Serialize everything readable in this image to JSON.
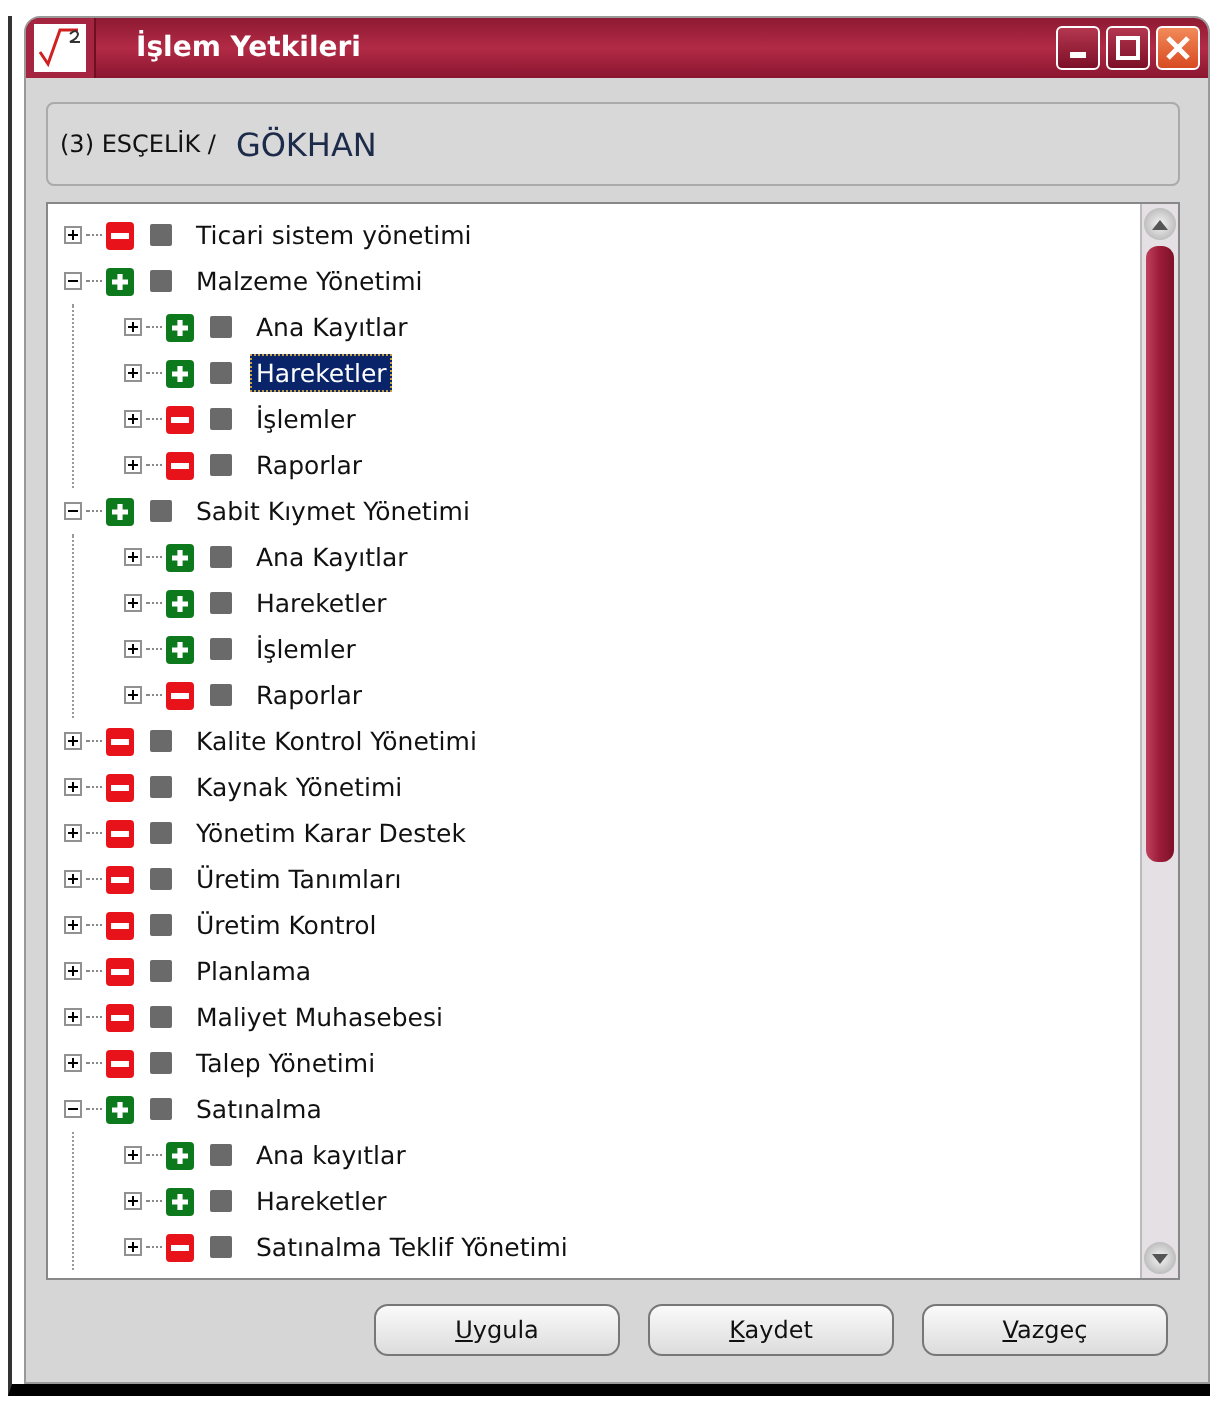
{
  "window": {
    "title": "İşlem Yetkileri"
  },
  "header": {
    "company": "(3) ESÇELİK /",
    "user": "GÖKHAN"
  },
  "tree": [
    {
      "label": "Ticari sistem yönetimi",
      "allowed": false,
      "expanded": false,
      "selected": false
    },
    {
      "label": "Malzeme Yönetimi",
      "allowed": true,
      "expanded": true,
      "selected": false,
      "children": [
        {
          "label": "Ana Kayıtlar",
          "allowed": true,
          "expanded": false,
          "selected": false
        },
        {
          "label": "Hareketler",
          "allowed": true,
          "expanded": false,
          "selected": true
        },
        {
          "label": "İşlemler",
          "allowed": false,
          "expanded": false,
          "selected": false
        },
        {
          "label": "Raporlar",
          "allowed": false,
          "expanded": false,
          "selected": false
        }
      ]
    },
    {
      "label": "Sabit Kıymet Yönetimi",
      "allowed": true,
      "expanded": true,
      "selected": false,
      "children": [
        {
          "label": "Ana Kayıtlar",
          "allowed": true,
          "expanded": false,
          "selected": false
        },
        {
          "label": "Hareketler",
          "allowed": true,
          "expanded": false,
          "selected": false
        },
        {
          "label": "İşlemler",
          "allowed": true,
          "expanded": false,
          "selected": false
        },
        {
          "label": "Raporlar",
          "allowed": false,
          "expanded": false,
          "selected": false
        }
      ]
    },
    {
      "label": "Kalite Kontrol Yönetimi",
      "allowed": false,
      "expanded": false,
      "selected": false
    },
    {
      "label": "Kaynak Yönetimi",
      "allowed": false,
      "expanded": false,
      "selected": false
    },
    {
      "label": "Yönetim Karar Destek",
      "allowed": false,
      "expanded": false,
      "selected": false
    },
    {
      "label": "Üretim Tanımları",
      "allowed": false,
      "expanded": false,
      "selected": false
    },
    {
      "label": "Üretim Kontrol",
      "allowed": false,
      "expanded": false,
      "selected": false
    },
    {
      "label": "Planlama",
      "allowed": false,
      "expanded": false,
      "selected": false
    },
    {
      "label": "Maliyet Muhasebesi",
      "allowed": false,
      "expanded": false,
      "selected": false
    },
    {
      "label": "Talep Yönetimi",
      "allowed": false,
      "expanded": false,
      "selected": false
    },
    {
      "label": "Satınalma",
      "allowed": true,
      "expanded": true,
      "selected": false,
      "children": [
        {
          "label": "Ana kayıtlar",
          "allowed": true,
          "expanded": false,
          "selected": false
        },
        {
          "label": "Hareketler",
          "allowed": true,
          "expanded": false,
          "selected": false
        },
        {
          "label": "Satınalma Teklif Yönetimi",
          "allowed": false,
          "expanded": false,
          "selected": false
        }
      ]
    }
  ],
  "buttons": [
    "Uygula",
    "Kaydet",
    "Vazgeç"
  ]
}
